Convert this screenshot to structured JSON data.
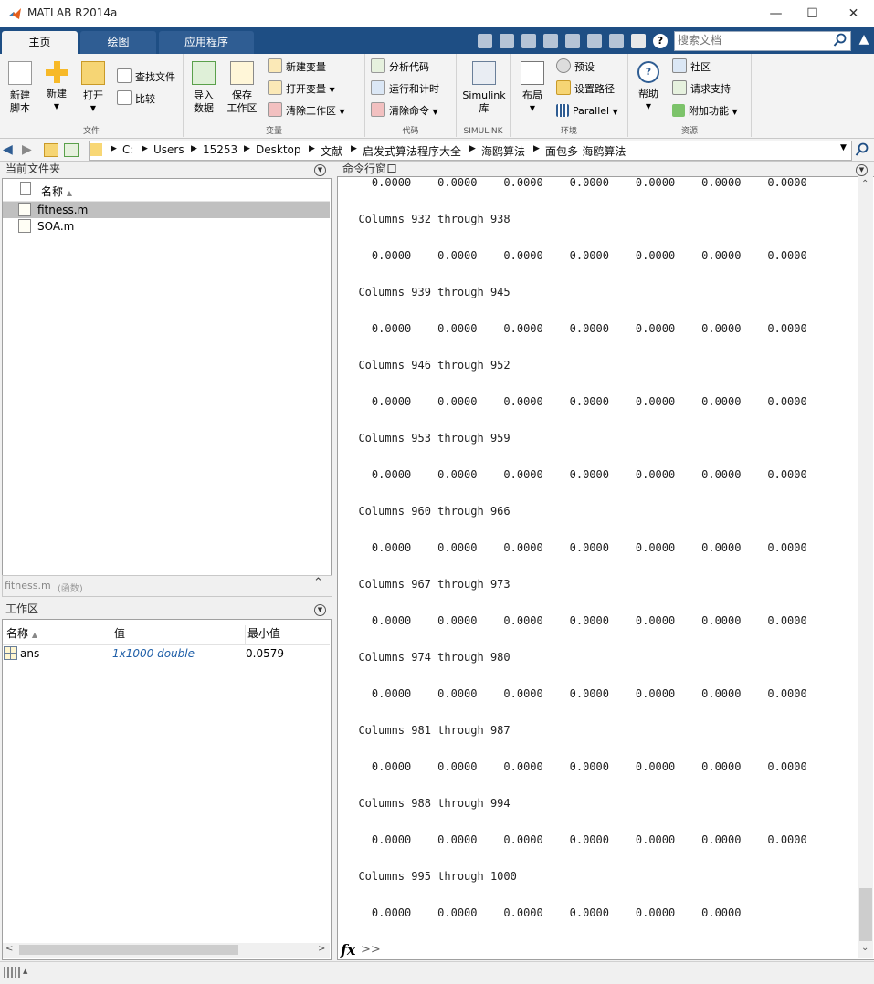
{
  "window": {
    "title": "MATLAB R2014a",
    "minimize": "—",
    "maximize": "☐",
    "close": "✕"
  },
  "tabs": [
    {
      "label": "主页"
    },
    {
      "label": "绘图"
    },
    {
      "label": "应用程序"
    }
  ],
  "search": {
    "placeholder": "搜索文档"
  },
  "ribbon": {
    "file": {
      "label": "文件",
      "new_script": "新建\n脚本",
      "new": "新建",
      "open": "打开",
      "find_files": "查找文件",
      "compare": "比较"
    },
    "variable": {
      "label": "变量",
      "import": "导入\n数据",
      "save": "保存\n工作区",
      "new_var": "新建变量",
      "open_var": "打开变量",
      "clear_ws": "清除工作区"
    },
    "code": {
      "label": "代码",
      "analyze": "分析代码",
      "run_time": "运行和计时",
      "clear_cmd": "清除命令"
    },
    "simulink": {
      "label": "SIMULINK",
      "lib": "Simulink\n库"
    },
    "env": {
      "label": "环境",
      "layout": "布局",
      "prefs": "预设",
      "set_path": "设置路径",
      "parallel": "Parallel"
    },
    "resources": {
      "label": "资源",
      "help": "帮助",
      "community": "社区",
      "support": "请求支持",
      "addons": "附加功能"
    }
  },
  "path": [
    "C:",
    "Users",
    "15253",
    "Desktop",
    "文献",
    "启发式算法程序大全",
    "海鸥算法",
    "面包多-海鸥算法"
  ],
  "current_folder": {
    "title": "当前文件夹",
    "col_name": "名称",
    "files": [
      {
        "name": "fitness.m",
        "selected": true
      },
      {
        "name": "SOA.m",
        "selected": false
      }
    ],
    "details_file": "fitness.m",
    "details_kind": "(函数)"
  },
  "workspace": {
    "title": "工作区",
    "columns": [
      "名称",
      "值",
      "最小值"
    ],
    "rows": [
      {
        "name": "ans",
        "value": "1x1000 double",
        "min": "0.0579"
      }
    ]
  },
  "command_window": {
    "title": "命令行窗口",
    "lines": [
      "    0.0000    0.0000    0.0000    0.0000    0.0000    0.0000    0.0000",
      "",
      "  Columns 932 through 938",
      "",
      "    0.0000    0.0000    0.0000    0.0000    0.0000    0.0000    0.0000",
      "",
      "  Columns 939 through 945",
      "",
      "    0.0000    0.0000    0.0000    0.0000    0.0000    0.0000    0.0000",
      "",
      "  Columns 946 through 952",
      "",
      "    0.0000    0.0000    0.0000    0.0000    0.0000    0.0000    0.0000",
      "",
      "  Columns 953 through 959",
      "",
      "    0.0000    0.0000    0.0000    0.0000    0.0000    0.0000    0.0000",
      "",
      "  Columns 960 through 966",
      "",
      "    0.0000    0.0000    0.0000    0.0000    0.0000    0.0000    0.0000",
      "",
      "  Columns 967 through 973",
      "",
      "    0.0000    0.0000    0.0000    0.0000    0.0000    0.0000    0.0000",
      "",
      "  Columns 974 through 980",
      "",
      "    0.0000    0.0000    0.0000    0.0000    0.0000    0.0000    0.0000",
      "",
      "  Columns 981 through 987",
      "",
      "    0.0000    0.0000    0.0000    0.0000    0.0000    0.0000    0.0000",
      "",
      "  Columns 988 through 994",
      "",
      "    0.0000    0.0000    0.0000    0.0000    0.0000    0.0000    0.0000",
      "",
      "  Columns 995 through 1000",
      "",
      "    0.0000    0.0000    0.0000    0.0000    0.0000    0.0000"
    ],
    "prompt": ">>",
    "fx": "fx"
  },
  "colors": {
    "tab_bar": "#1e4e84",
    "selected_row": "#c0c0c0",
    "link_value": "#1f5fa8"
  }
}
